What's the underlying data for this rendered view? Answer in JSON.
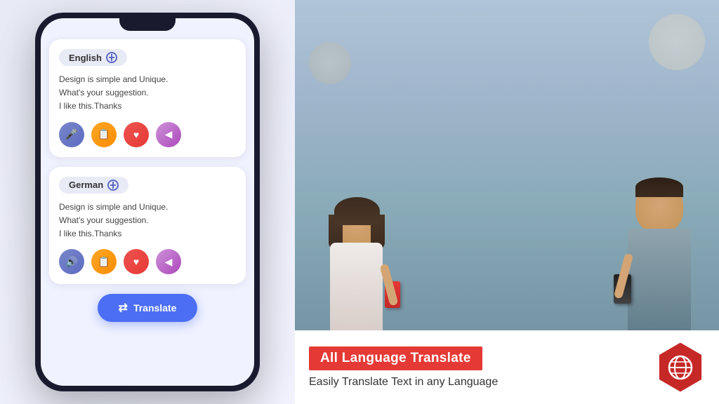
{
  "left_panel": {
    "background_color": "#e8eaf6"
  },
  "phone": {
    "source_card": {
      "language": "English",
      "text_line1": "Design is simple and Unique.",
      "text_line2": "What's your suggestion.",
      "text_line3": "I like this.Thanks",
      "actions": {
        "mic": "🎤",
        "copy": "🗂",
        "heart": "❤",
        "share": "🔗"
      }
    },
    "target_card": {
      "language": "German",
      "text_line1": "Design is simple and Unique.",
      "text_line2": "What's your suggestion.",
      "text_line3": "I like this.Thanks",
      "actions": {
        "speaker": "🔊",
        "copy": "🗂",
        "heart": "❤",
        "share": "🔗"
      }
    },
    "translate_button": "Translate"
  },
  "banner": {
    "title": "All Language Translate",
    "subtitle": "Easily Translate Text in any  Language",
    "icon_color": "#c62828"
  }
}
